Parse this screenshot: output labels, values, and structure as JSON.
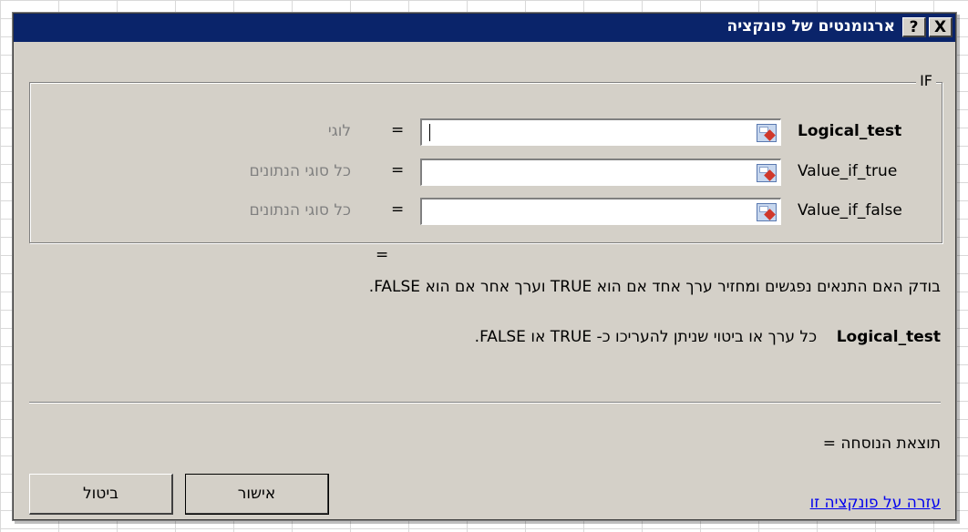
{
  "dialog": {
    "title": "ארגומנטים של פונקציה",
    "help_button": "?",
    "close_button": "X"
  },
  "function": {
    "name": "IF",
    "arguments": [
      {
        "name": "Logical_test",
        "value": "",
        "hint": "לוגי",
        "bold": true
      },
      {
        "name": "Value_if_true",
        "value": "",
        "hint": "כל סוגי הנתונים",
        "bold": false
      },
      {
        "name": "Value_if_false",
        "value": "",
        "hint": "כל סוגי הנתונים",
        "bold": false
      }
    ],
    "equals": "=",
    "result_equals": "="
  },
  "description": {
    "function_text": "בודק האם התנאים נפגשים ומחזיר ערך אחד  אם הוא TRUE וערך אחר אם הוא FALSE.",
    "argument_name": "Logical_test",
    "argument_text": "כל ערך או ביטוי שניתן להעריכו כ- TRUE או FALSE."
  },
  "footer": {
    "formula_result_label": "תוצאת הנוסחה =",
    "help_link": "עזרה על פונקציה זו",
    "ok_label": "אישור",
    "cancel_label": "ביטול"
  },
  "colors": {
    "titlebar": "#0a246a",
    "dialog_bg": "#d4d0c8",
    "hint_text": "#808080",
    "link": "#0000ee"
  },
  "icons": {
    "ref_button": "range-select-icon"
  }
}
